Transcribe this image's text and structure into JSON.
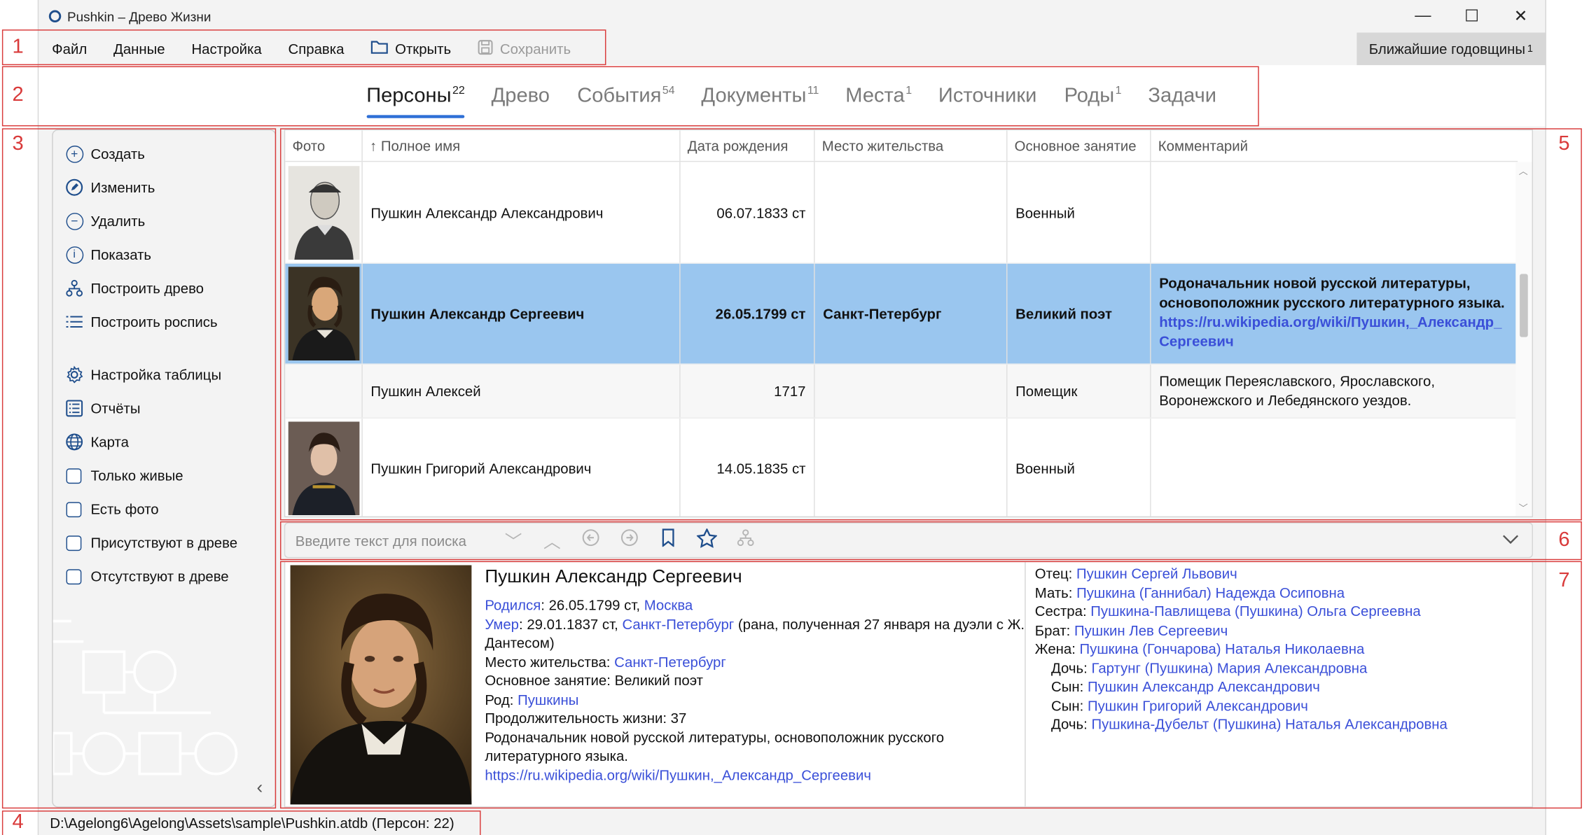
{
  "window": {
    "title": "Pushkin – Древо Жизни",
    "minimize": "—",
    "maximize": "☐",
    "close": "✕"
  },
  "menu": {
    "items": [
      "Файл",
      "Данные",
      "Настройка",
      "Справка"
    ],
    "open_label": "Открыть",
    "save_label": "Сохранить",
    "anniversaries_label": "Ближайшие годовщины",
    "anniversaries_count": "1"
  },
  "tabs": [
    {
      "label": "Персоны",
      "count": "22",
      "active": true
    },
    {
      "label": "Древо",
      "count": ""
    },
    {
      "label": "События",
      "count": "54"
    },
    {
      "label": "Документы",
      "count": "11"
    },
    {
      "label": "Места",
      "count": "1"
    },
    {
      "label": "Источники",
      "count": ""
    },
    {
      "label": "Роды",
      "count": "1"
    },
    {
      "label": "Задачи",
      "count": ""
    }
  ],
  "sidebar": {
    "actions": [
      "Создать",
      "Изменить",
      "Удалить",
      "Показать",
      "Построить древо",
      "Построить роспись"
    ],
    "tools": [
      "Настройка таблицы",
      "Отчёты",
      "Карта"
    ],
    "filters": [
      "Только живые",
      "Есть фото",
      "Присутствуют в древе",
      "Отсутствуют в древе"
    ]
  },
  "table": {
    "columns": [
      "Фото",
      "↑ Полное имя",
      "Дата рождения",
      "Место жительства",
      "Основное занятие",
      "Комментарий"
    ],
    "rows": [
      {
        "name": "Пушкин Александр Александрович",
        "birth": "06.07.1833 ст",
        "residence": "",
        "occupation": "Военный",
        "comment": "",
        "link": ""
      },
      {
        "name": "Пушкин Александр Сергеевич",
        "birth": "26.05.1799 ст",
        "residence": "Санкт-Петербург",
        "occupation": "Великий поэт",
        "comment": "Родоначальник новой русской литературы, основоположник русского литературного языка.",
        "link": "https://ru.wikipedia.org/wiki/Пушкин,_Александр_Сергеевич"
      },
      {
        "name": "Пушкин Алексей",
        "birth": "1717",
        "residence": "",
        "occupation": "Помещик",
        "comment": "Помещик Переяславского, Ярославского, Воронежского и Лебедянского уездов.",
        "link": ""
      },
      {
        "name": "Пушкин Григорий Александрович",
        "birth": "14.05.1835 ст",
        "residence": "",
        "occupation": "Военный",
        "comment": "",
        "link": ""
      }
    ]
  },
  "search": {
    "placeholder": "Введите текст для поиска"
  },
  "details": {
    "name": "Пушкин Александр Сергеевич",
    "born_label": "Родился",
    "born_date": ": 26.05.1799 ст, ",
    "born_place": "Москва",
    "died_label": "Умер",
    "died_date": ": 29.01.1837 ст, ",
    "died_place": "Санкт-Петербург",
    "died_note": " (рана, полученная 27 января на дуэли с Ж. Дантесом)",
    "residence_label": "Место жительства: ",
    "residence": "Санкт-Петербург",
    "occupation": "Основное занятие: Великий поэт",
    "clan_label": "Род: ",
    "clan": "Пушкины",
    "lifespan": "Продолжительность жизни: 37",
    "comment": "Родоначальник новой русской литературы, основоположник русского литературного языка.",
    "link": "https://ru.wikipedia.org/wiki/Пушкин,_Александр_Сергеевич",
    "relatives": [
      {
        "role": "Отец: ",
        "name": "Пушкин Сергей Львович",
        "indent": false
      },
      {
        "role": "Мать: ",
        "name": "Пушкина (Ганнибал) Надежда Осиповна",
        "indent": false
      },
      {
        "role": "Сестра: ",
        "name": "Пушкина-Павлищева (Пушкина) Ольга Сергеевна",
        "indent": false
      },
      {
        "role": "Брат: ",
        "name": "Пушкин Лев Сергеевич",
        "indent": false
      },
      {
        "role": "Жена: ",
        "name": "Пушкина (Гончарова) Наталья Николаевна",
        "indent": false
      },
      {
        "role": "Дочь: ",
        "name": "Гартунг (Пушкина) Мария Александровна",
        "indent": true
      },
      {
        "role": "Сын: ",
        "name": "Пушкин Александр Александрович",
        "indent": true
      },
      {
        "role": "Сын: ",
        "name": "Пушкин Григорий Александрович",
        "indent": true
      },
      {
        "role": "Дочь: ",
        "name": "Пушкина-Дубельт (Пушкина) Наталья Александровна",
        "indent": true
      }
    ]
  },
  "status": {
    "path": "D:\\Agelong6\\Agelong\\Assets\\sample\\Pushkin.atdb (Персон: 22)"
  },
  "annotations": [
    "1",
    "2",
    "3",
    "4",
    "5",
    "6",
    "7"
  ],
  "colors": {
    "accent": "#2e6fd6",
    "selection": "#9ac6ef",
    "link": "#3a4fd8",
    "annotation": "#d93a3a"
  }
}
